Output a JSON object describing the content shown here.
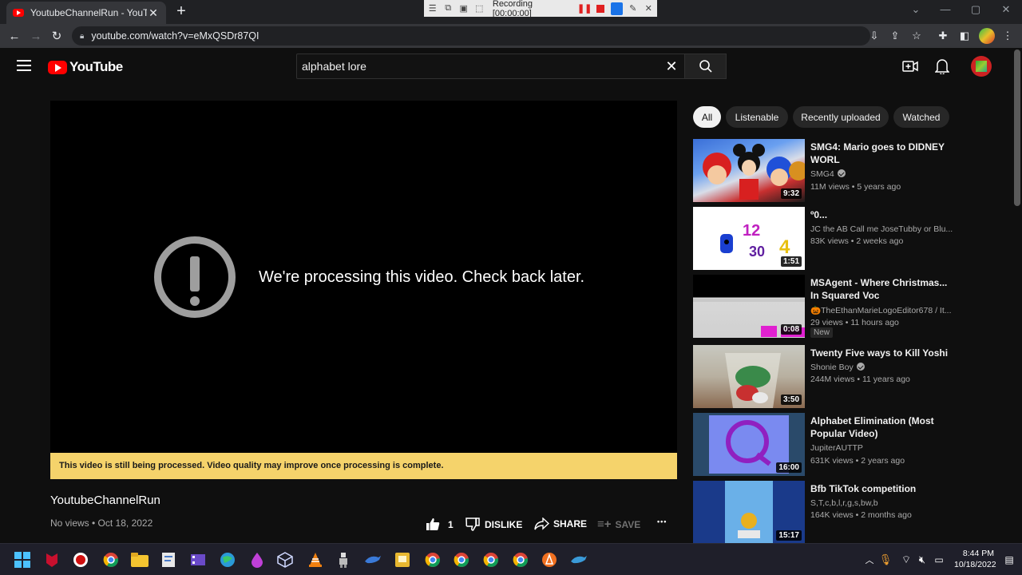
{
  "browser": {
    "tab_title": "YoutubeChannelRun - YouTube",
    "new_tab_label": "+",
    "url": "youtube.com/watch?v=eMxQSDr87QI",
    "recorder": {
      "label": "Recording [00:00:00]"
    }
  },
  "header": {
    "logo_text": "YouTube",
    "search_value": "alphabet lore"
  },
  "player": {
    "message": "We're processing this video. Check back later.",
    "banner": "This video is still being processed. Video quality may improve once processing is complete."
  },
  "video": {
    "title": "YoutubeChannelRun",
    "meta": "No views • Oct 18, 2022",
    "like_count": "1",
    "dislike_label": "DISLIKE",
    "share_label": "SHARE",
    "save_label": "SAVE",
    "more_label": "•••"
  },
  "chips": [
    "All",
    "Listenable",
    "Recently uploaded",
    "Watched"
  ],
  "recommendations": [
    {
      "title": "SMG4: Mario goes to DIDNEY WORL",
      "channel": "SMG4",
      "verified": true,
      "stats": "11M views • 5 years ago",
      "duration": "9:32"
    },
    {
      "title": "º0...",
      "channel": "JC the AB Call me JoseTubby or Blu...",
      "verified": false,
      "stats": "83K views • 2 weeks ago",
      "duration": "1:51"
    },
    {
      "title": "MSAgent - Where Christmas... In Squared Voc",
      "channel": "🎃TheEthanMarieLogoEditor678 / It...",
      "verified": false,
      "stats": "29 views • 11 hours ago",
      "duration": "0:08",
      "badge": "New"
    },
    {
      "title": "Twenty Five ways to Kill Yoshi",
      "channel": "Shonie Boy",
      "verified": true,
      "stats": "244M views • 11 years ago",
      "duration": "3:50"
    },
    {
      "title": "Alphabet Elimination (Most Popular Video)",
      "channel": "JupiterAUTTP",
      "verified": false,
      "stats": "631K views • 2 years ago",
      "duration": "16:00"
    },
    {
      "title": "Bfb TikTok competition",
      "channel": "S,T,c,b,l,r,g,s,bw,b",
      "verified": false,
      "stats": "164K views • 2 months ago",
      "duration": "15:17"
    }
  ],
  "taskbar": {
    "time": "8:44 PM",
    "date": "10/18/2022"
  },
  "colors": {
    "youtube_red": "#ff0000",
    "banner_yellow": "#f5d36b",
    "background": "#0f0f0f"
  }
}
